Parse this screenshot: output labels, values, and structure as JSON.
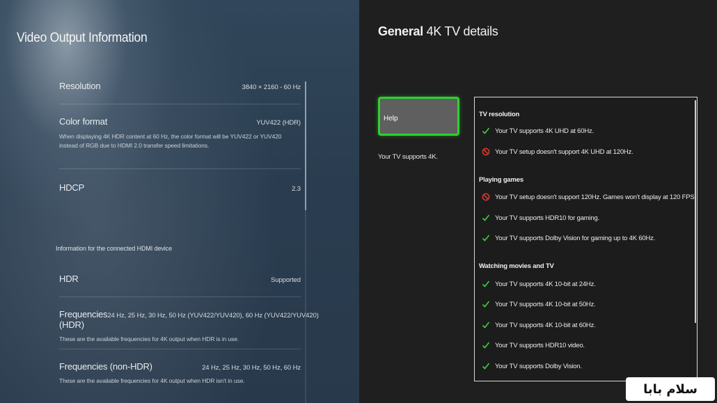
{
  "left": {
    "title": "Video Output Information",
    "rows": [
      {
        "label": "Resolution",
        "value": "3840 × 2160 - 60 Hz",
        "description": ""
      },
      {
        "label": "Color format",
        "value": "YUV422 (HDR)",
        "description": "When displaying 4K HDR content at 60 Hz, the color format will be YUV422 or YUV420 instead of RGB due to HDMI 2.0 transfer speed limitations."
      },
      {
        "label": "HDCP",
        "value": "2.3",
        "description": ""
      }
    ],
    "section_heading": "Information for the connected HDMI device",
    "device_rows": [
      {
        "label": "HDR",
        "value": "Supported",
        "description": ""
      },
      {
        "label": "Frequencies (HDR)",
        "value": "24 Hz, 25 Hz, 30 Hz, 50 Hz (YUV422/YUV420), 60 Hz (YUV422/YUV420)",
        "description": "These are the available frequencies for 4K output when HDR is in use."
      },
      {
        "label": "Frequencies (non-HDR)",
        "value": "24 Hz, 25 Hz, 30 Hz, 50 Hz, 60 Hz",
        "description": "These are the available frequencies for 4K output when HDR isn't in use."
      }
    ]
  },
  "right": {
    "title_bold": "General",
    "title_rest": "4K TV details",
    "help_button": "Help",
    "support_note": "Your TV supports 4K.",
    "groups": [
      {
        "title": "TV resolution",
        "items": [
          {
            "status": "ok",
            "icon": "check-icon",
            "text": "Your TV supports 4K UHD at 60Hz."
          },
          {
            "status": "no",
            "icon": "prohibited-icon",
            "text": "Your TV setup doesn't support 4K UHD at 120Hz."
          }
        ]
      },
      {
        "title": "Playing games",
        "items": [
          {
            "status": "no",
            "icon": "prohibited-icon",
            "text": "Your TV setup doesn't support 120Hz. Games won't display at 120 FPS."
          },
          {
            "status": "ok",
            "icon": "check-icon",
            "text": "Your TV supports HDR10 for gaming."
          },
          {
            "status": "ok",
            "icon": "check-icon",
            "text": "Your TV supports Dolby Vision for gaming up to 4K 60Hz."
          }
        ]
      },
      {
        "title": "Watching movies and TV",
        "items": [
          {
            "status": "ok",
            "icon": "check-icon",
            "text": "Your TV supports 4K 10-bit at 24Hz."
          },
          {
            "status": "ok",
            "icon": "check-icon",
            "text": "Your TV supports 4K 10-bit at 50Hz."
          },
          {
            "status": "ok",
            "icon": "check-icon",
            "text": "Your TV supports 4K 10-bit at 60Hz."
          },
          {
            "status": "ok",
            "icon": "check-icon",
            "text": "Your TV supports HDR10 video."
          },
          {
            "status": "ok",
            "icon": "check-icon",
            "text": "Your TV supports Dolby Vision."
          }
        ]
      }
    ]
  },
  "watermark": "سلام بابا",
  "colors": {
    "focus_green": "#2fd12f",
    "check_green": "#3fcf3f",
    "prohibited_red": "#e03a2f"
  }
}
